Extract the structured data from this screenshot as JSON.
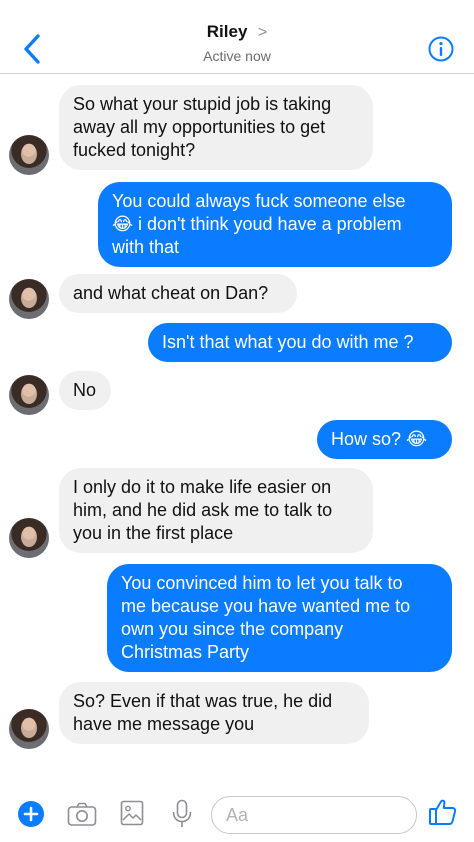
{
  "header": {
    "contact_name": "Riley",
    "chevron": ">",
    "status": "Active now"
  },
  "composer": {
    "placeholder": "Aa"
  },
  "messages": [
    {
      "sender": "Riley",
      "lines": [
        "So what your stupid job is taking",
        "away all my opportunities to get",
        "fucked tonight?"
      ]
    },
    {
      "sender": "me",
      "lines": [
        "You could always fuck someone else",
        "😂 i don't think youd have a problem",
        "with that"
      ]
    },
    {
      "sender": "Riley",
      "lines": [
        "and what cheat on Dan?"
      ]
    },
    {
      "sender": "me",
      "lines": [
        "Isn't that what you do with me ?"
      ]
    },
    {
      "sender": "Riley",
      "lines": [
        "No"
      ]
    },
    {
      "sender": "me",
      "lines": [
        "How so? 😂"
      ]
    },
    {
      "sender": "Riley",
      "lines": [
        "I only do it to make life easier on",
        "him, and he did ask me to talk to",
        "you in the first place"
      ]
    },
    {
      "sender": "me",
      "lines": [
        "You convinced him to let you talk to",
        "me because you have wanted me to",
        "own you since the company",
        "Christmas Party"
      ]
    },
    {
      "sender": "Riley",
      "lines": [
        "So? Even if that was true, he did",
        "have me message you"
      ]
    }
  ],
  "colors": {
    "accent": "#0a7cff",
    "incoming_bubble": "#f0f0f0"
  }
}
